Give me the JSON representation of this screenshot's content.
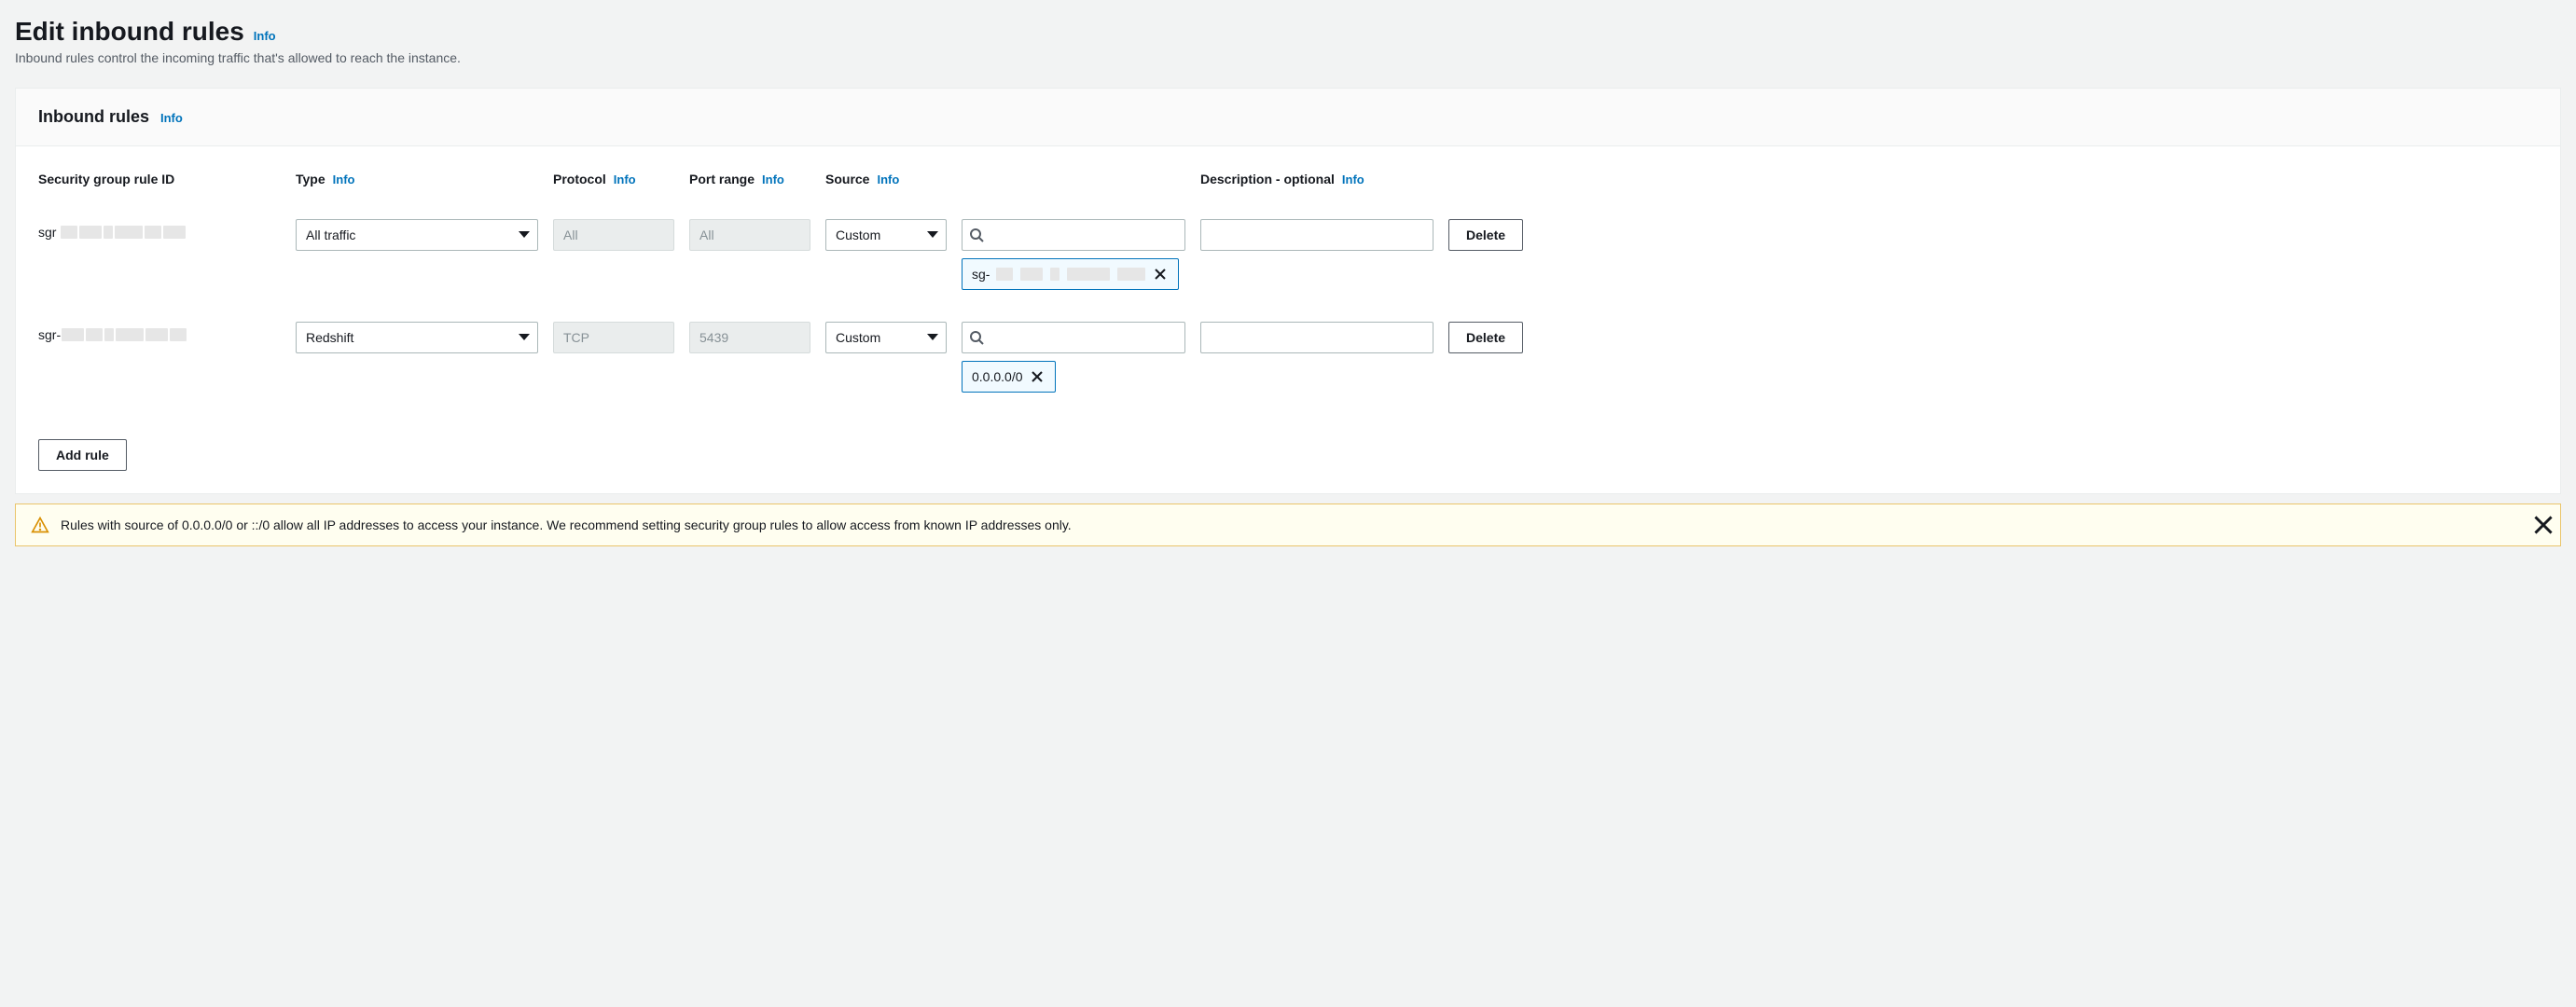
{
  "page": {
    "title": "Edit inbound rules",
    "info_label": "Info",
    "subtitle": "Inbound rules control the incoming traffic that's allowed to reach the instance."
  },
  "panel": {
    "heading": "Inbound rules",
    "info_label": "Info"
  },
  "columns": {
    "rule_id": "Security group rule ID",
    "type": "Type",
    "protocol": "Protocol",
    "port_range": "Port range",
    "source": "Source",
    "description": "Description - optional",
    "info_label": "Info"
  },
  "rules": [
    {
      "id_prefix": "sgr",
      "type": "All traffic",
      "protocol": "All",
      "port_range": "All",
      "source_mode": "Custom",
      "source_search": "",
      "source_token": "sg-",
      "token_redacted": true,
      "description": ""
    },
    {
      "id_prefix": "sgr-",
      "type": "Redshift",
      "protocol": "TCP",
      "port_range": "5439",
      "source_mode": "Custom",
      "source_search": "",
      "source_token": "0.0.0.0/0",
      "token_redacted": false,
      "description": ""
    }
  ],
  "actions": {
    "delete": "Delete",
    "add_rule": "Add rule"
  },
  "alert": {
    "text": "Rules with source of 0.0.0.0/0 or ::/0 allow all IP addresses to access your instance. We recommend setting security group rules to allow access from known IP addresses only."
  }
}
